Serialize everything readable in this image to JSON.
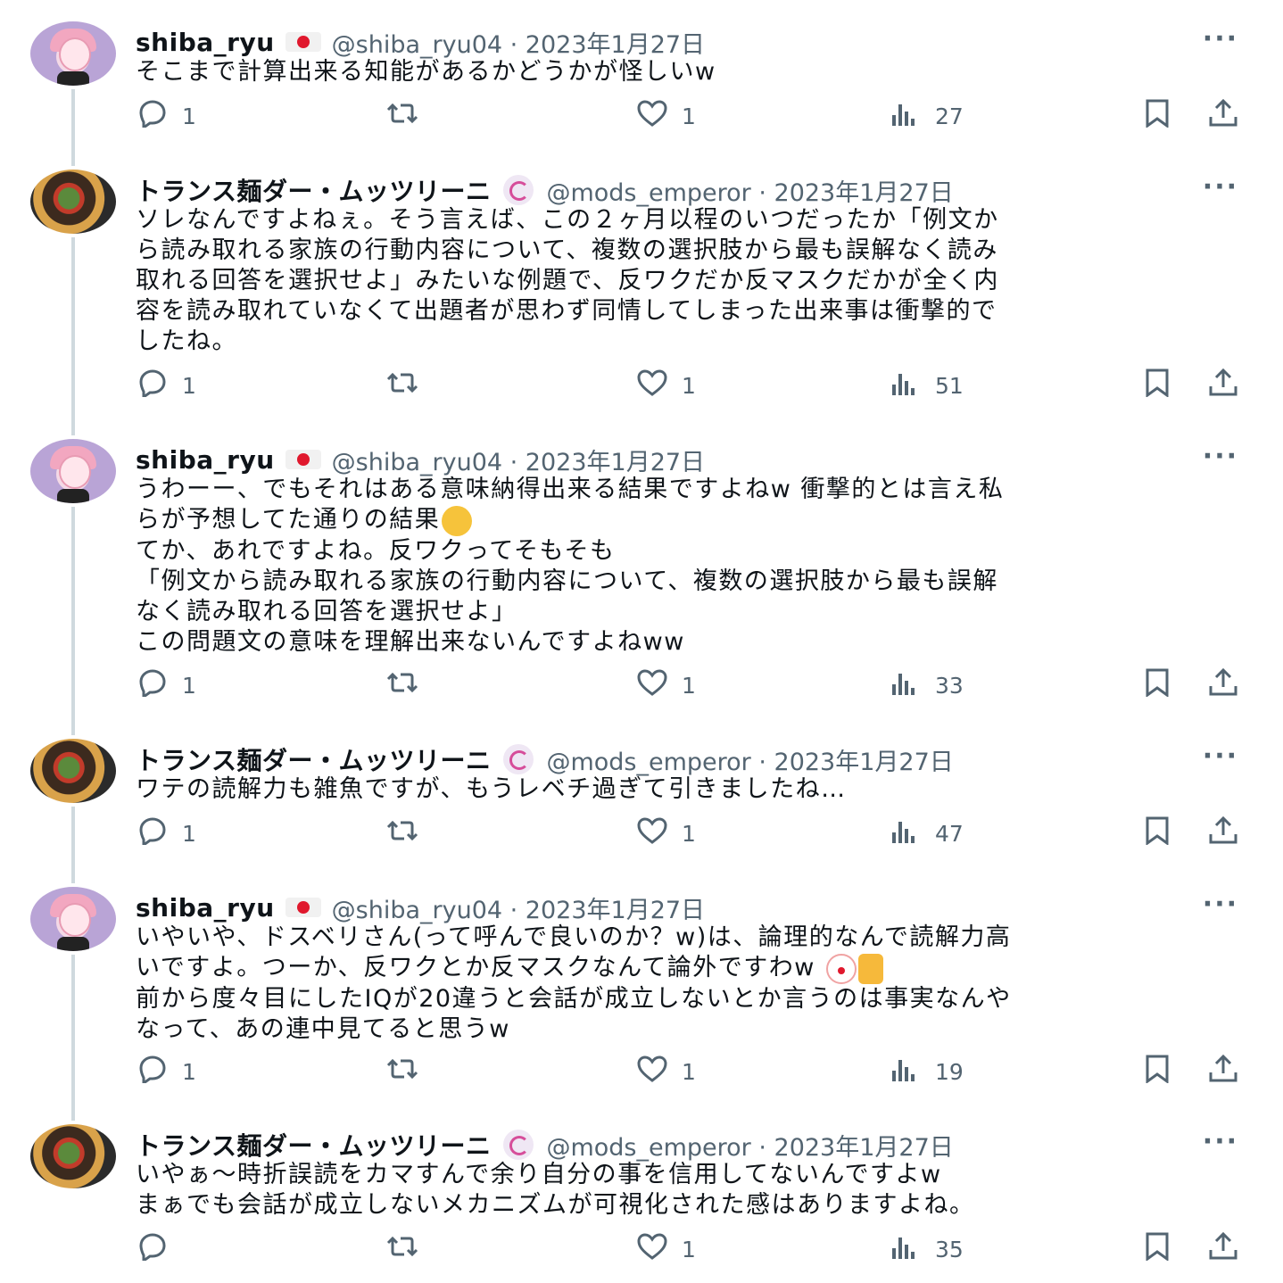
{
  "tweets": [
    {
      "name": "shiba_ryu",
      "avatar": "shiba",
      "badge": "jp-flag",
      "meta": "@shiba_ryu04 · 2023年1月27日",
      "lines": [
        "そこまで計算出来る知能があるかどうかが怪しいw"
      ],
      "replies": "1",
      "likes": "1",
      "views": "27"
    },
    {
      "name": "トランス麺ダー・ムッツリーニ",
      "avatar": "mods",
      "badge": "swirl",
      "meta": "@mods_emperor · 2023年1月27日",
      "lines": [
        "ソレなんですよねぇ。そう言えば、この２ヶ月以程のいつだったか「例文か",
        "ら読み取れる家族の行動内容について、複数の選択肢から最も誤解なく読み",
        "取れる回答を選択せよ」みたいな例題で、反ワクだか反マスクだかが全く内",
        "容を読み取れていなくて出題者が思わず同情してしまった出来事は衝撃的で",
        "したね。"
      ],
      "replies": "1",
      "likes": "1",
      "views": "51"
    },
    {
      "name": "shiba_ryu",
      "avatar": "shiba",
      "badge": "jp-flag",
      "meta": "@shiba_ryu04 · 2023年1月27日",
      "lines": [
        "うわーー、でもそれはある意味納得出来る結果ですよねw 衝撃的とは言え私",
        "らが予想してた通りの結果",
        "てか、あれですよね。反ワクってそもそも",
        "「例文から読み取れる家族の行動内容について、複数の選択肢から最も誤解",
        "なく読み取れる回答を選択せよ」",
        "この問題文の意味を理解出来ないんですよねww"
      ],
      "emoji_line": 1,
      "emojis": [
        "hand-over-mouth-emoji"
      ],
      "replies": "1",
      "likes": "1",
      "views": "33"
    },
    {
      "name": "トランス麺ダー・ムッツリーニ",
      "avatar": "mods",
      "badge": "swirl",
      "meta": "@mods_emperor · 2023年1月27日",
      "lines": [
        "ワテの読解力も雑魚ですが、もうレベチ過ぎて引きましたね…"
      ],
      "replies": "1",
      "likes": "1",
      "views": "47"
    },
    {
      "name": "shiba_ryu",
      "avatar": "shiba",
      "badge": "jp-flag",
      "meta": "@shiba_ryu04 · 2023年1月27日",
      "lines": [
        "いやいや、ドスベリさん(って呼んで良いのか？w)は、論理的なんで読解力高",
        "いですよ。つーか、反ワクとか反マスクなんて論外ですわw ",
        "前から度々目にしたIQが20違うと会話が成立しないとか言うのは事実なんや",
        "なって、あの連中見てると思うw"
      ],
      "emoji_line": 1,
      "emojis": [
        "clown-emoji",
        "thumbs-down-emoji"
      ],
      "replies": "1",
      "likes": "1",
      "views": "19"
    },
    {
      "name": "トランス麺ダー・ムッツリーニ",
      "avatar": "mods",
      "badge": "swirl",
      "meta": "@mods_emperor · 2023年1月27日",
      "lines": [
        "いやぁ～時折誤読をカマすんで余り自分の事を信用してないんですよw",
        "まぁでも会話が成立しないメカニズムが可視化された感はありますよね。"
      ],
      "replies": "",
      "likes": "1",
      "views": "35"
    }
  ],
  "more_label": "···"
}
